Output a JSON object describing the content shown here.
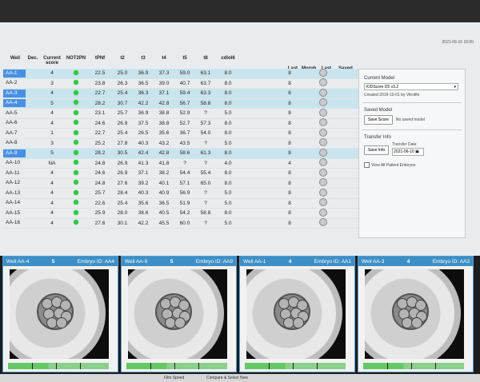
{
  "datestamp": "2021-06-10 16:00",
  "columns": [
    "Well",
    "Dec.",
    "Current score",
    "NOT2PN",
    "tPNf",
    "t2",
    "t3",
    "t4",
    "t5",
    "t8",
    "cdlol6"
  ],
  "extra_columns": [
    "Last stage",
    "Morph. grade",
    "Last image",
    "Saved score"
  ],
  "rows": [
    {
      "well": "AA-1",
      "dec": "",
      "score": "4",
      "tPNf": "22.5",
      "t2": "25.0",
      "t3": "36.9",
      "t4": "37.3",
      "t5": "59.0",
      "t8": "63.1",
      "c": "8.0",
      "last": "8",
      "hl": true,
      "sel": true
    },
    {
      "well": "AA-2",
      "dec": "",
      "score": "3",
      "tPNf": "23.8",
      "t2": "26.3",
      "t3": "36.5",
      "t4": "39.0",
      "t5": "40.7",
      "t8": "63.7",
      "c": "8.0",
      "last": "8",
      "hl": false,
      "sel": false
    },
    {
      "well": "AA-3",
      "dec": "",
      "score": "4",
      "tPNf": "22.7",
      "t2": "25.4",
      "t3": "36.3",
      "t4": "37.1",
      "t5": "59.4",
      "t8": "63.3",
      "c": "8.0",
      "last": "8",
      "hl": true,
      "sel": true
    },
    {
      "well": "AA-4",
      "dec": "",
      "score": "5",
      "tPNf": "28.2",
      "t2": "30.7",
      "t3": "42.2",
      "t4": "42.8",
      "t5": "56.7",
      "t8": "58.8",
      "c": "8.0",
      "last": "8",
      "hl": true,
      "sel": true
    },
    {
      "well": "AA-5",
      "dec": "",
      "score": "4",
      "tPNf": "23.1",
      "t2": "25.7",
      "t3": "36.9",
      "t4": "38.8",
      "t5": "52.9",
      "t8": "?",
      "c": "5.0",
      "last": "8",
      "hl": false,
      "sel": false
    },
    {
      "well": "AA-6",
      "dec": "",
      "score": "4",
      "tPNf": "24.6",
      "t2": "26.9",
      "t3": "37.5",
      "t4": "38.8",
      "t5": "52.7",
      "t8": "57.3",
      "c": "8.0",
      "last": "8",
      "hl": false,
      "sel": false
    },
    {
      "well": "AA-7",
      "dec": "",
      "score": "1",
      "tPNf": "22.7",
      "t2": "25.4",
      "t3": "26.5",
      "t4": "35.6",
      "t5": "36.7",
      "t8": "54.0",
      "c": "8.0",
      "last": "8",
      "hl": false,
      "sel": false
    },
    {
      "well": "AA-8",
      "dec": "",
      "score": "3",
      "tPNf": "25.2",
      "t2": "27.8",
      "t3": "40.3",
      "t4": "43.2",
      "t5": "43.5",
      "t8": "?",
      "c": "5.0",
      "last": "8",
      "hl": false,
      "sel": false
    },
    {
      "well": "AA-9",
      "dec": "",
      "score": "5",
      "tPNf": "28.2",
      "t2": "30.5",
      "t3": "42.4",
      "t4": "42.8",
      "t5": "58.6",
      "t8": "61.3",
      "c": "8.0",
      "last": "8",
      "hl": true,
      "sel": true
    },
    {
      "well": "AA-10",
      "dec": "",
      "score": "NA",
      "tPNf": "24.8",
      "t2": "26.9",
      "t3": "41.3",
      "t4": "41.8",
      "t5": "?",
      "t8": "?",
      "c": "4.0",
      "last": "4",
      "hl": false,
      "sel": false
    },
    {
      "well": "AA-11",
      "dec": "",
      "score": "4",
      "tPNf": "24.6",
      "t2": "26.9",
      "t3": "37.1",
      "t4": "38.2",
      "t5": "54.4",
      "t8": "55.4",
      "c": "8.0",
      "last": "8",
      "hl": false,
      "sel": false
    },
    {
      "well": "AA-12",
      "dec": "",
      "score": "4",
      "tPNf": "24.8",
      "t2": "27.6",
      "t3": "39.2",
      "t4": "40.1",
      "t5": "57.1",
      "t8": "65.0",
      "c": "8.0",
      "last": "8",
      "hl": false,
      "sel": false
    },
    {
      "well": "AA-13",
      "dec": "",
      "score": "4",
      "tPNf": "25.7",
      "t2": "28.4",
      "t3": "40.3",
      "t4": "40.9",
      "t5": "56.9",
      "t8": "?",
      "c": "5.0",
      "last": "8",
      "hl": false,
      "sel": false
    },
    {
      "well": "AA-14",
      "dec": "",
      "score": "4",
      "tPNf": "22.6",
      "t2": "25.4",
      "t3": "35.6",
      "t4": "36.5",
      "t5": "51.9",
      "t8": "?",
      "c": "5.0",
      "last": "8",
      "hl": false,
      "sel": false
    },
    {
      "well": "AA-15",
      "dec": "",
      "score": "4",
      "tPNf": "25.9",
      "t2": "28.0",
      "t3": "38.6",
      "t4": "40.5",
      "t5": "54.2",
      "t8": "58.8",
      "c": "8.0",
      "last": "8",
      "hl": false,
      "sel": false
    },
    {
      "well": "AA-16",
      "dec": "",
      "score": "4",
      "tPNf": "27.6",
      "t2": "30.1",
      "t3": "42.2",
      "t4": "45.5",
      "t5": "60.0",
      "t8": "?",
      "c": "5.0",
      "last": "8",
      "hl": false,
      "sel": false
    }
  ],
  "panel": {
    "current_model_title": "Current Model",
    "model_value": "KIDScore D5 v3.2",
    "created_text": "Created 2019-10-01 by Vitrolife",
    "saved_model_title": "Saved Model",
    "save_score_label": "Save Score",
    "no_saved_model": "No saved model",
    "transfer_title": "Transfer Info",
    "save_info_label": "Save Info",
    "transfer_date_label": "Transfer Date",
    "transfer_date_value": "2021-06-10",
    "all_patient_label": "View All Patient Embryos"
  },
  "thumbs": [
    {
      "well": "Well AA-4",
      "score": "5",
      "embryo": "Embryo ID: AA4"
    },
    {
      "well": "Well AA-9",
      "score": "5",
      "embryo": "Embryo ID: AA9"
    },
    {
      "well": "Well AA-1",
      "score": "4",
      "embryo": "Embryo ID: AA1"
    },
    {
      "well": "Well AA-3",
      "score": "4",
      "embryo": "Embryo ID: AA3"
    }
  ],
  "footer": {
    "film_speed": "Film Speed",
    "compare": "Compare & Select New"
  },
  "colors": {
    "highlight": "#c9e4ec",
    "selected_well": "#4a90e2",
    "status_dot": "#2ecc40",
    "thumb_header": "#3d8fc6"
  }
}
